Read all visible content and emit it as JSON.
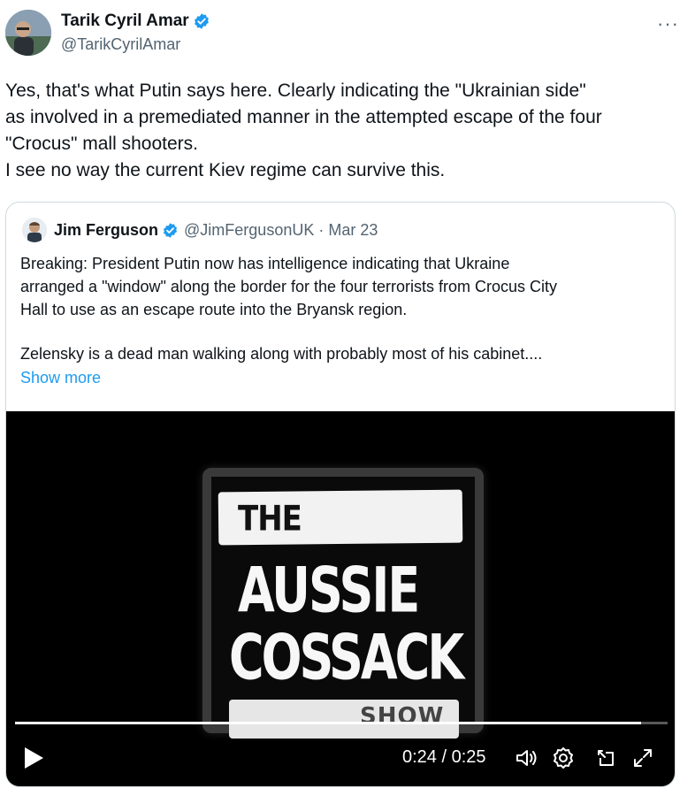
{
  "tweet": {
    "author_name": "Tarik Cyril Amar",
    "author_handle": "@TarikCyrilAmar",
    "more_label": "···",
    "text_lines": [
      "Yes, that's what Putin says here. Clearly indicating the \"Ukrainian side\"",
      "as involved in a premediated manner in the attempted escape of the four",
      "\"Crocus\" mall shooters.",
      "I see no way the current Kiev regime can survive this."
    ]
  },
  "quote": {
    "author_name": "Jim Ferguson",
    "author_handle": "@JimFergusonUK",
    "separator": "·",
    "date": "Mar 23",
    "paragraph1": [
      "Breaking: President Putin now has intelligence indicating that Ukraine",
      "arranged a \"window\" along the border for the four terrorists from Crocus City",
      "Hall to use as an escape route into the Bryansk region."
    ],
    "paragraph2": [
      "Zelensky is a dead man walking along with probably most of his cabinet...."
    ],
    "show_more_label": "Show more"
  },
  "video": {
    "logo_line1": "THE",
    "logo_line2": "AUSSIE",
    "logo_line3": "COSSACK",
    "logo_line4": "SHOW",
    "time_display": "0:24 / 0:25",
    "progress_fraction": 0.96
  },
  "icons": {
    "verified": "verified-badge-icon",
    "play": "play-icon",
    "volume": "volume-icon",
    "settings": "settings-gear-icon",
    "pip": "picture-in-picture-icon",
    "fullscreen": "fullscreen-icon"
  },
  "colors": {
    "accent": "#1d9bf0",
    "text": "#0f1419",
    "secondary_text": "#536471",
    "border": "#cfd9de",
    "video_bg": "#000000"
  }
}
